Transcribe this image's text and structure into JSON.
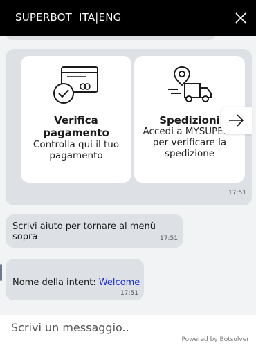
{
  "header": {
    "brand": "SUPERBOT",
    "language_toggle": "ITA|ENG",
    "close_icon": "close-icon"
  },
  "cards": [
    {
      "icon": "card-check-icon",
      "title": "Verifica pagamento",
      "description": "Controlla qui il tuo pagamento"
    },
    {
      "icon": "delivery-truck-icon",
      "title": "Spedizioni",
      "description": "Accedi a MYSUPERB\nper verificare la\nspedizione"
    }
  ],
  "carousel": {
    "time": "17:51",
    "next_icon": "arrow-right-icon"
  },
  "messages": [
    {
      "text": "Scrivi aiuto per tornare al menù sopra",
      "time": "17:51"
    },
    {
      "prefix": "Nome della intent: ",
      "link": "Welcome",
      "time": "17:51"
    }
  ],
  "input": {
    "placeholder": "Scrivi un messaggio.."
  },
  "footer": {
    "powered_by": "Powered by Botsolver"
  }
}
